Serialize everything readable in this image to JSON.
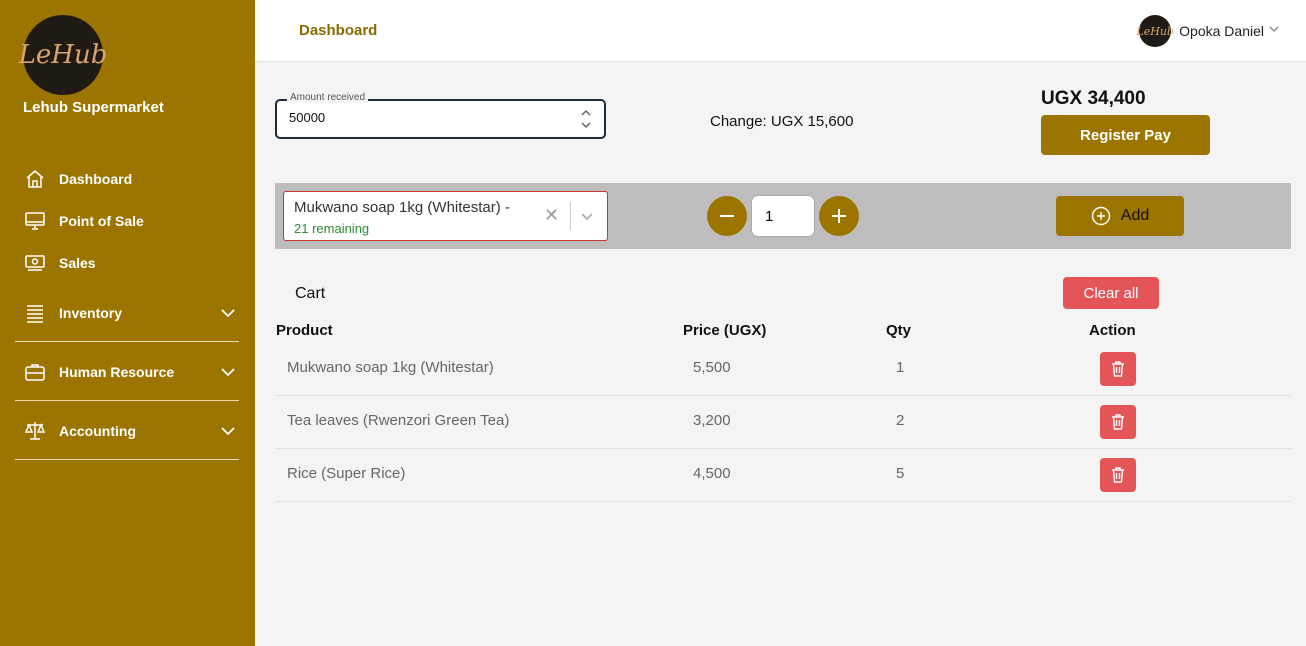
{
  "sidebar": {
    "logo_text": "LeHub",
    "brand": "Lehub Supermarket",
    "items": [
      {
        "label": "Dashboard",
        "icon": "home-icon"
      },
      {
        "label": "Point of Sale",
        "icon": "monitor-icon"
      },
      {
        "label": "Sales",
        "icon": "cash-icon"
      },
      {
        "label": "Inventory",
        "icon": "stack-icon"
      },
      {
        "label": "Human Resource",
        "icon": "briefcase-icon"
      },
      {
        "label": "Accounting",
        "icon": "scale-icon"
      }
    ]
  },
  "header": {
    "title": "Dashboard",
    "user_name": "Opoka Daniel",
    "avatar_text": "LeHub"
  },
  "payment": {
    "amount_label": "Amount received",
    "amount_value": "50000",
    "change_text": "Change: UGX 15,600",
    "total_text": "UGX 34,400",
    "register_label": "Register Pay"
  },
  "add_bar": {
    "product_selected": "Mukwano soap 1kg (Whitestar) -",
    "product_remaining": "21 remaining",
    "quantity": "1",
    "add_label": "Add"
  },
  "cart": {
    "title": "Cart",
    "clear_label": "Clear all",
    "headers": {
      "product": "Product",
      "price": "Price (UGX)",
      "qty": "Qty",
      "action": "Action"
    },
    "rows": [
      {
        "product": "Mukwano soap 1kg (Whitestar)",
        "price": "5,500",
        "qty": "1"
      },
      {
        "product": "Tea leaves (Rwenzori Green Tea)",
        "price": "3,200",
        "qty": "2"
      },
      {
        "product": "Rice (Super Rice)",
        "price": "4,500",
        "qty": "5"
      }
    ]
  },
  "colors": {
    "accent": "#9c7400",
    "danger": "#e45558",
    "success": "#2e8b2e"
  }
}
